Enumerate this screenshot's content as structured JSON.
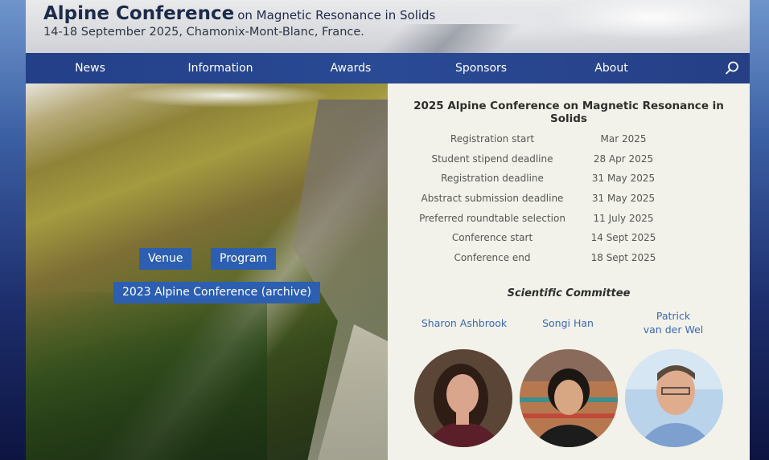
{
  "header": {
    "title_main": "Alpine Conference",
    "title_sub": "on Magnetic Resonance in Solids",
    "subtitle": "14-18 September 2025, Chamonix-Mont-Blanc, France."
  },
  "nav": {
    "items": [
      "News",
      "Information",
      "Awards",
      "Sponsors",
      "About"
    ],
    "search_icon": "search-icon"
  },
  "hero": {
    "venue_label": "Venue",
    "program_label": "Program",
    "archive_label": "2023 Alpine Conference (archive)"
  },
  "info": {
    "title": "2025 Alpine Conference on Magnetic Resonance in Solids",
    "dates": [
      {
        "label": "Registration start",
        "value": "Mar 2025"
      },
      {
        "label": "Student stipend deadline",
        "value": "28 Apr 2025"
      },
      {
        "label": "Registration deadline",
        "value": "31 May 2025"
      },
      {
        "label": "Abstract submission deadline",
        "value": "31 May 2025"
      },
      {
        "label": "Preferred roundtable selection",
        "value": "11 July 2025"
      },
      {
        "label": "Conference start",
        "value": "14 Sept 2025"
      },
      {
        "label": "Conference end",
        "value": "18 Sept 2025"
      }
    ],
    "committee_title": "Scientific Committee",
    "members": [
      {
        "name": "Sharon Ashbrook"
      },
      {
        "name": "Songi Han"
      },
      {
        "name_line1": "Patrick",
        "name_line2": "van der Wel"
      }
    ]
  },
  "colors": {
    "nav_bg": "#2a4a95",
    "button_bg": "#2c5fb2",
    "link": "#3a68b8",
    "panel_bg": "#f2f2ea"
  }
}
